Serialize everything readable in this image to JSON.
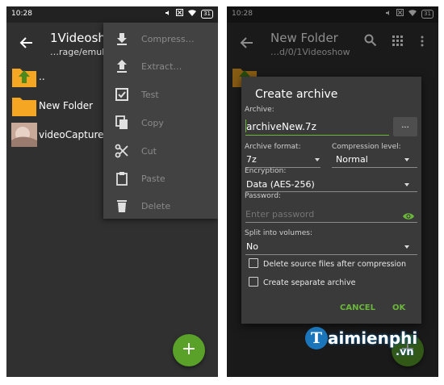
{
  "left": {
    "status": {
      "time": "10:28",
      "battery": "31"
    },
    "header": {
      "title": "1Videoshow",
      "subtitle": "…rage/emula"
    },
    "files": [
      {
        "name": ".."
      },
      {
        "name": "New Folder"
      },
      {
        "name": "videoCapture.jp"
      }
    ],
    "menu": [
      {
        "label": "Compress…",
        "icon": "download-icon"
      },
      {
        "label": "Extract…",
        "icon": "upload-icon"
      },
      {
        "label": "Test",
        "icon": "check-box-icon"
      },
      {
        "label": "Copy",
        "icon": "copy-icon"
      },
      {
        "label": "Cut",
        "icon": "scissors-icon"
      },
      {
        "label": "Paste",
        "icon": "clipboard-icon"
      },
      {
        "label": "Delete",
        "icon": "trash-icon"
      }
    ],
    "fab": "+"
  },
  "right": {
    "status": {
      "time": "10:28",
      "battery": "31"
    },
    "header": {
      "title": "New Folder",
      "subtitle": "…d/0/1Videoshow"
    },
    "dialog": {
      "title": "Create archive",
      "archive_label": "Archive:",
      "archive_value": "archiveNew.7z",
      "browse_label": "...",
      "format_label": "Archive format:",
      "format_value": "7z",
      "level_label": "Compression level:",
      "level_value": "Normal",
      "encryption_label": "Encryption:",
      "encryption_value": "Data (AES-256)",
      "password_label": "Password:",
      "password_placeholder": "Enter password",
      "split_label": "Split into volumes:",
      "split_value": "No",
      "delete_after_label": "Delete source files after compression",
      "separate_label": "Create separate archive",
      "cancel_label": "CANCEL",
      "ok_label": "OK"
    },
    "fab": "+"
  },
  "watermark": {
    "brand": "aimienphi",
    "initial": "T",
    "domain": ".vn"
  },
  "colors": {
    "accent": "#6ab73a",
    "fab": "#5aa12a",
    "folder": "#f5a623",
    "folder_up_arrow": "#4c8a1e",
    "background": "#303030",
    "menu": "#424242"
  }
}
